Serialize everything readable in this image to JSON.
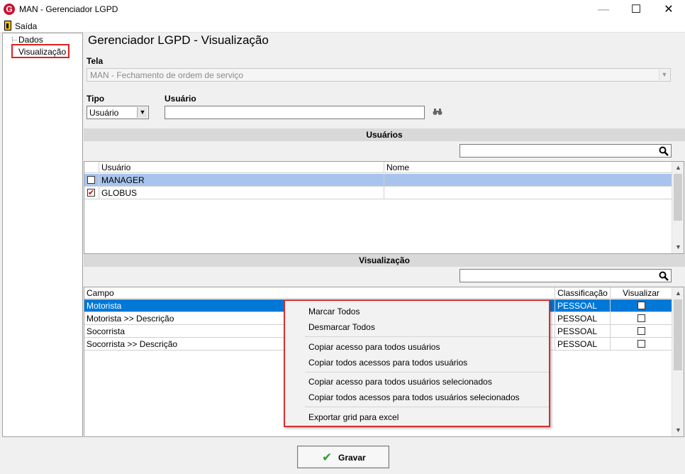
{
  "window": {
    "logo": "G",
    "title": "MAN - Gerenciador LGPD",
    "minimize": "—",
    "maximize": "☐",
    "close": "✕"
  },
  "menubar": {
    "exit_label": "Saída"
  },
  "tree": {
    "items": [
      "Dados",
      "Visualização"
    ]
  },
  "page_title": "Gerenciador LGPD - Visualização",
  "tela": {
    "label": "Tela",
    "value": "MAN - Fechamento de ordem de serviço"
  },
  "tipo": {
    "label": "Tipo",
    "value": "Usuário"
  },
  "usuario": {
    "label": "Usuário",
    "value": ""
  },
  "usuarios_section": {
    "title": "Usuários",
    "columns": [
      "Usuário",
      "Nome"
    ],
    "rows": [
      {
        "usuario": "MANAGER",
        "nome": "",
        "checked": false
      },
      {
        "usuario": "GLOBUS",
        "nome": "",
        "checked": true
      }
    ]
  },
  "visualizacao_section": {
    "title": "Visualização",
    "columns": [
      "Campo",
      "Classificação",
      "Visualizar"
    ],
    "rows": [
      {
        "campo": "Motorista",
        "classificacao": "PESSOAL",
        "visualizar": false
      },
      {
        "campo": "Motorista >> Descrição",
        "classificacao": "PESSOAL",
        "visualizar": false
      },
      {
        "campo": "Socorrista",
        "classificacao": "PESSOAL",
        "visualizar": false
      },
      {
        "campo": "Socorrista >> Descrição",
        "classificacao": "PESSOAL",
        "visualizar": false
      }
    ]
  },
  "context_menu": {
    "items": [
      "Marcar Todos",
      "Desmarcar Todos",
      "Copiar acesso para todos usuários",
      "Copiar todos acessos para todos usuários",
      "Copiar acesso para todos usuários selecionados",
      "Copiar todos acessos para todos usuários selecionados",
      "Exportar grid para excel"
    ]
  },
  "save_button": {
    "label": "Gravar"
  },
  "colors": {
    "selected_row": "#0078d7",
    "highlight_row": "#a8c4ec",
    "annotation_red": "#e02020",
    "check_green": "#2e9e2e"
  }
}
